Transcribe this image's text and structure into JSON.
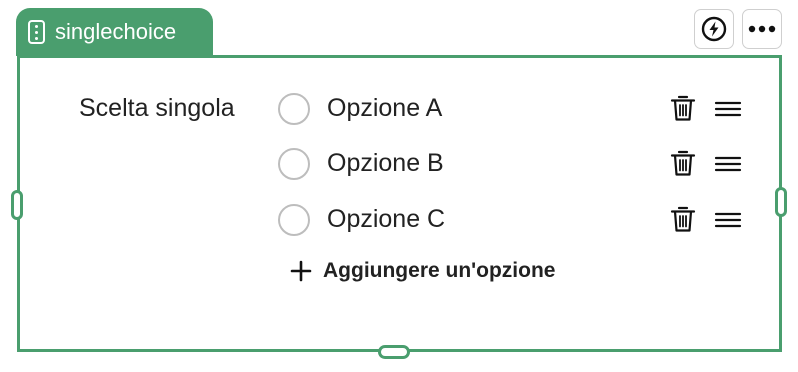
{
  "tab": {
    "label": "singlechoice",
    "icon": "dots-vertical-icon"
  },
  "actions": {
    "bolt_icon": "bolt-icon",
    "more_icon": "more-horizontal-icon"
  },
  "question": {
    "label": "Scelta singola"
  },
  "options": [
    {
      "label": "Opzione A"
    },
    {
      "label": "Opzione B"
    },
    {
      "label": "Opzione C"
    }
  ],
  "add_option": {
    "label": "Aggiungere un'opzione"
  },
  "colors": {
    "accent": "#4a9e6e",
    "text": "#222222",
    "radio_border": "#bdbdbd"
  }
}
